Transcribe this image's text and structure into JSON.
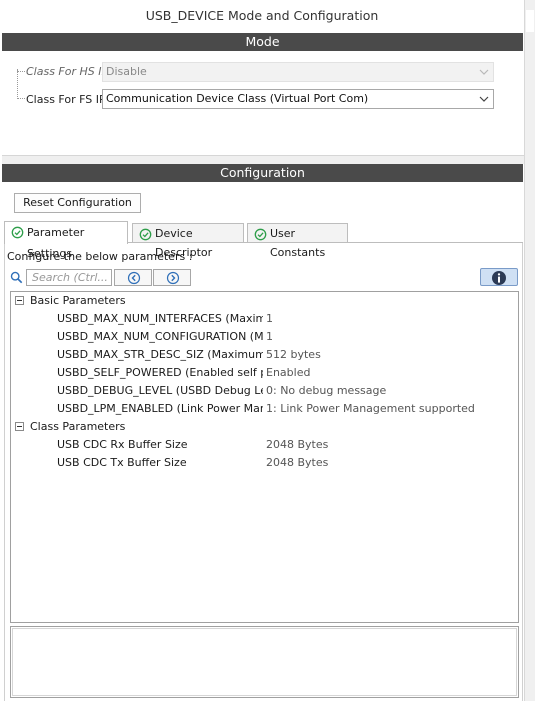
{
  "window": {
    "title": "USB_DEVICE Mode and Configuration"
  },
  "mode": {
    "header": "Mode",
    "hs_ip": {
      "label": "Class For HS IP",
      "value": "Disable"
    },
    "fs_ip": {
      "label": "Class For FS IP",
      "value": "Communication Device Class (Virtual Port Com)"
    }
  },
  "configuration": {
    "header": "Configuration",
    "reset_label": "Reset Configuration",
    "tabs": [
      {
        "label": "Parameter Settings"
      },
      {
        "label": "Device Descriptor"
      },
      {
        "label": "User Constants"
      }
    ],
    "instruction": "Configure the below parameters :",
    "search_placeholder": "Search (Ctrl...",
    "groups": [
      {
        "label": "Basic Parameters",
        "params": [
          {
            "name": "USBD_MAX_NUM_INTERFACES (Maximum...",
            "value": "1"
          },
          {
            "name": "USBD_MAX_NUM_CONFIGURATION (Ma...",
            "value": "1"
          },
          {
            "name": "USBD_MAX_STR_DESC_SIZ (Maximum si...",
            "value": "512 bytes"
          },
          {
            "name": "USBD_SELF_POWERED (Enabled self po...",
            "value": "Enabled"
          },
          {
            "name": "USBD_DEBUG_LEVEL (USBD Debug Level)",
            "value": "0: No debug message"
          },
          {
            "name": "USBD_LPM_ENABLED (Link Power Mana...",
            "value": "1: Link Power Management supported"
          }
        ]
      },
      {
        "label": "Class Parameters",
        "params": [
          {
            "name": "USB CDC Rx Buffer Size",
            "value": "2048 Bytes"
          },
          {
            "name": "USB CDC Tx Buffer Size",
            "value": "2048 Bytes"
          }
        ]
      }
    ]
  },
  "colors": {
    "section_bar": "#4a4a4a",
    "tab_ok_icon": "#2e9e4a",
    "info_button": "#cfe0f4",
    "nav_icon": "#2f6fb8"
  },
  "icons": {
    "tab_status": "check-circle-icon",
    "search": "search-icon",
    "prev": "arrow-left-icon",
    "next": "arrow-right-icon",
    "info": "info-icon",
    "dropdown": "chevron-down-icon",
    "expander": "collapse-icon"
  }
}
